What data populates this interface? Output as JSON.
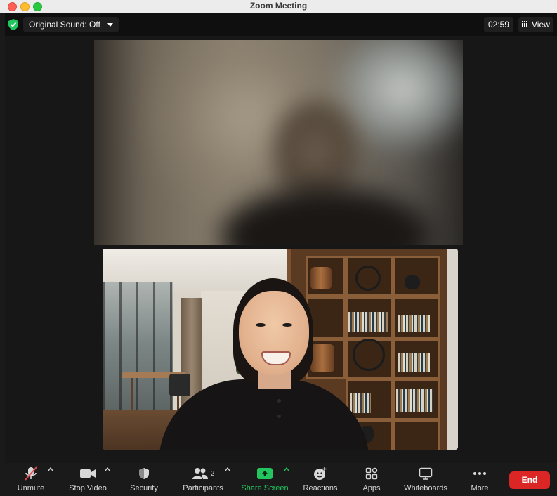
{
  "window": {
    "title": "Zoom Meeting"
  },
  "topbar": {
    "security_icon": "green-shield-check-icon",
    "original_sound_label": "Original Sound: Off",
    "timer": "02:59",
    "view_label": "View"
  },
  "videos": {
    "top_tile": {
      "state": "blurred participant video"
    },
    "bottom_tile": {
      "state": "participant video - woman smiling in office with bookshelf"
    }
  },
  "toolbar": {
    "items": [
      {
        "label": "Unmute",
        "icon": "muted-microphone-icon",
        "has_caret": true
      },
      {
        "label": "Stop Video",
        "icon": "video-camera-icon",
        "has_caret": true
      },
      {
        "label": "Security",
        "icon": "shield-icon",
        "has_caret": false
      },
      {
        "label": "Participants",
        "icon": "participants-icon",
        "count": "2",
        "has_caret": true
      },
      {
        "label": "Share Screen",
        "icon": "share-screen-icon",
        "has_caret": true
      },
      {
        "label": "Reactions",
        "icon": "reactions-icon",
        "has_caret": false
      },
      {
        "label": "Apps",
        "icon": "apps-icon",
        "has_caret": false
      },
      {
        "label": "Whiteboards",
        "icon": "whiteboard-icon",
        "has_caret": false
      },
      {
        "label": "More",
        "icon": "more-dots-icon",
        "has_caret": false
      }
    ],
    "end_label": "End"
  },
  "colors": {
    "share_screen_green": "#22c55e",
    "end_red": "#dc2626",
    "mute_red": "#e5484d"
  }
}
